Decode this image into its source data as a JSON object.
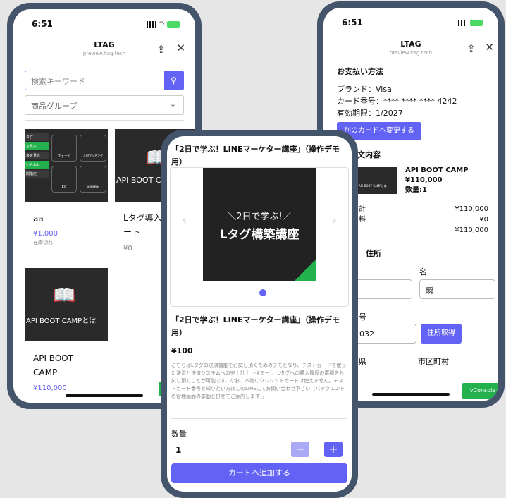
{
  "left": {
    "time": "6:51",
    "title": "LTAG",
    "subtitle": "preview.ltag.tech",
    "search_placeholder": "検索キーワード",
    "group_placeholder": "商品グループ",
    "tile": {
      "rows": [
        "タグ",
        "を見る",
        "客を見る",
        "い合わせ",
        "問指定"
      ],
      "c1": "フォーム",
      "c2": "人材マッチング",
      "c3": "EC",
      "c4": "地図連携"
    },
    "products": [
      {
        "name": "aa",
        "price": "¥1,000",
        "stock": "在庫切れ"
      },
      {
        "name": "Lタグ導入デモ",
        "partial": "Lタグ導入サ\nート",
        "price": "¥0"
      },
      {
        "name": "API BOOT CAMP",
        "name_wrapped": "API BOOT\nCAMP",
        "price": "¥110,000",
        "img": "API BOOT CAMPとは"
      }
    ],
    "prod2_img": "API BOOT CA"
  },
  "right": {
    "time": "6:51",
    "title": "LTAG",
    "subtitle": "preview.ltag.tech",
    "payment_heading": "お支払い方法",
    "brand": "ブランド：Visa",
    "card": "カード番号：**** **** **** 4242",
    "expiry": "有効期限：1/2027",
    "change_btn": "別のカードへ変更する",
    "order_heading": "文内容",
    "item_name": "API BOOT CAMP",
    "item_price": "¥110,000",
    "item_qty": "数量:1",
    "item_img": "API BOOT CAMPとは",
    "rows": [
      {
        "label": "計",
        "value": "¥110,000"
      },
      {
        "label": "料",
        "value": "¥0"
      },
      {
        "label": "",
        "value": "¥110,000"
      }
    ],
    "address_heading": "住所",
    "first_name": "名",
    "first_value": "瞬",
    "postal_label": "号",
    "postal_value": "032",
    "fetch_btn": "住所取得",
    "pref": "県",
    "city": "市区町村",
    "vconsole": "vConsole"
  },
  "modal": {
    "title": "「2日で学ぶ！LINEマーケター講座」（操作デモ用）",
    "img_line1": "＼2日で学ぶ!／",
    "img_line2": "Lタグ構築講座",
    "name": "「2日で学ぶ！LINEマーケター講座」（操作デモ用）",
    "price": "¥100",
    "desc": "こちらはLタグの決済機能をお試し頂くためのデモとなり、テストカードを使った決済と決済システムへの売上計上（ダミー）、Lタグへの購入履歴の蓄積をお試し頂くことが可能です。なお、本物のクレジットカードは使えません。テストカード番号を知りたい方はこのLINEにてお問い合わせ下さい（バックエンドの管理画面の挙動と併せてご案内します）。",
    "qty_label": "数量",
    "qty_value": "1",
    "minus": "−",
    "plus": "+",
    "add_btn": "カートへ追加する"
  },
  "colors": {
    "accent": "#6262f5",
    "frame": "#44546a",
    "green": "#22b14c"
  }
}
